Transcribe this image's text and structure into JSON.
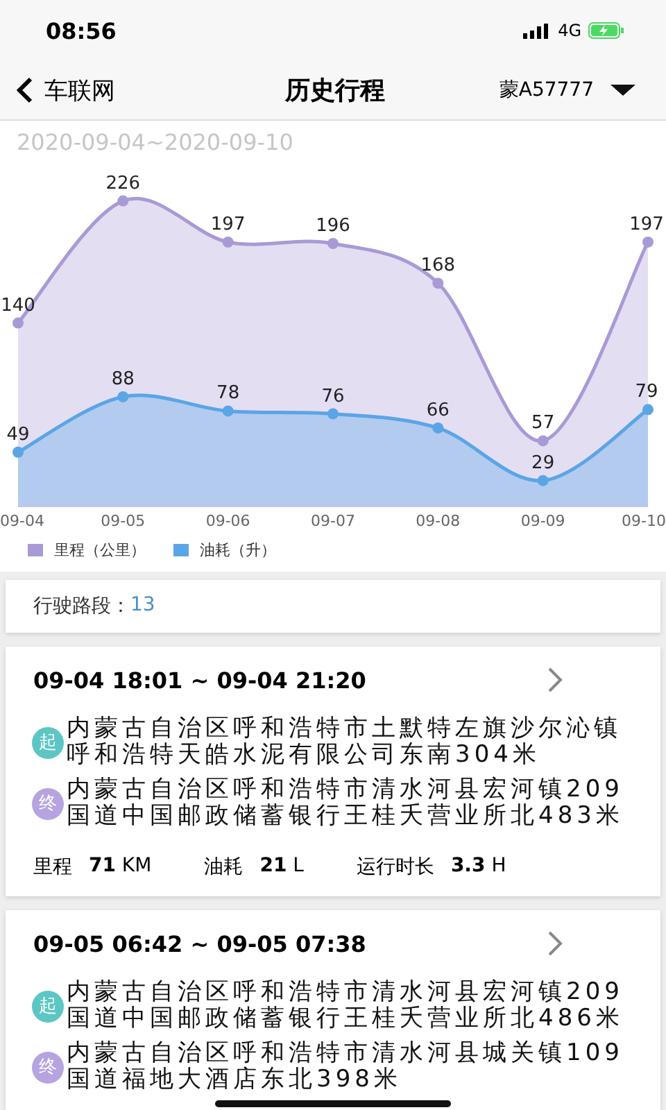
{
  "status_bar": {
    "time": "08:56",
    "network": "4G"
  },
  "nav": {
    "back_label": "车联网",
    "title": "历史行程",
    "plate": "蒙A57777"
  },
  "chart": {
    "date_range": "2020-09-04~2020-09-10",
    "chart_data": {
      "type": "area",
      "categories": [
        "09-04",
        "09-05",
        "09-06",
        "09-07",
        "09-08",
        "09-09",
        "09-10"
      ],
      "data_labels": true,
      "series": [
        {
          "name": "里程（公里）",
          "color": "#a99ad6",
          "values": [
            140,
            226,
            197,
            196,
            168,
            57,
            197
          ]
        },
        {
          "name": "油耗（升）",
          "color": "#5aa5e6",
          "values": [
            49,
            88,
            78,
            76,
            66,
            29,
            79
          ]
        }
      ]
    }
  },
  "summary": {
    "label": "行驶路段：",
    "value": "13"
  },
  "trips": [
    {
      "time_range": "09-04 18:01 ~ 09-04 21:20",
      "places": [
        {
          "kind": "start",
          "badge": "起",
          "address": "内蒙古自治区呼和浩特市土默特左旗沙尔沁镇呼和浩特天皓水泥有限公司东南304米"
        },
        {
          "kind": "end",
          "badge": "终",
          "address": "内蒙古自治区呼和浩特市清水河县宏河镇209国道中国邮政储蓄银行王桂夭营业所北483米"
        }
      ],
      "stats": [
        {
          "label": "里程",
          "value": "71",
          "unit": "KM"
        },
        {
          "label": "油耗",
          "value": "21",
          "unit": "L"
        },
        {
          "label": "运行时长",
          "value": "3.3",
          "unit": "H"
        }
      ]
    },
    {
      "time_range": "09-05 06:42 ~ 09-05 07:38",
      "places": [
        {
          "kind": "start",
          "badge": "起",
          "address": "内蒙古自治区呼和浩特市清水河县宏河镇209国道中国邮政储蓄银行王桂夭营业所北486米"
        },
        {
          "kind": "end",
          "badge": "终",
          "address": "内蒙古自治区呼和浩特市清水河县城关镇109国道福地大酒店东北398米"
        }
      ]
    }
  ]
}
